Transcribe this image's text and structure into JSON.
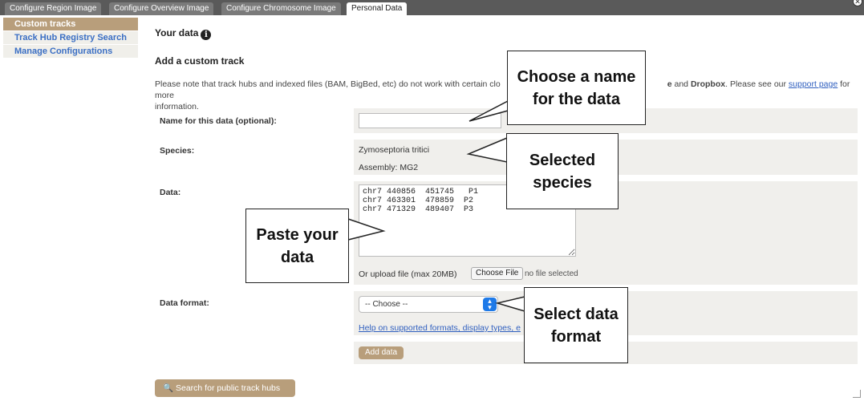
{
  "tabs": [
    {
      "label": "Configure Region Image",
      "active": false
    },
    {
      "label": "Configure Overview Image",
      "active": false
    },
    {
      "label": "Configure Chromosome Image",
      "active": false
    },
    {
      "label": "Personal Data",
      "active": true
    }
  ],
  "sidebar": {
    "items": [
      {
        "label": "Custom tracks",
        "active": true
      },
      {
        "label": "Track Hub Registry Search",
        "active": false
      },
      {
        "label": "Manage Configurations",
        "active": false
      }
    ]
  },
  "main": {
    "title": "Your data",
    "section_title": "Add a custom track",
    "note_part1": "Please note that track hubs and indexed files (BAM, BigBed, etc) do not work with certain clo",
    "note_bold_fragment": "e",
    "note_part2": " and ",
    "note_bold2": "Dropbox",
    "note_part3": ". Please see our ",
    "note_link": "support page",
    "note_part4": " for more",
    "note_line2": "information.",
    "form": {
      "name_label": "Name for this data (optional):",
      "name_value": "",
      "species_label": "Species:",
      "species_value": "Zymoseptoria tritici",
      "assembly_value": "Assembly: MG2",
      "data_label": "Data:",
      "data_value": "chr7 440856  451745   P1\nchr7 463301  478859  P2\nchr7 471329  489407  P3",
      "upload_label": "Or upload file (max 20MB)",
      "choose_file_button": "Choose File",
      "file_status": "no file selected",
      "format_label": "Data format:",
      "format_selected": "-- Choose --",
      "help_link": "Help on supported formats, display types, e",
      "add_button": "Add data"
    },
    "search_hubs_button": "Search for public track hubs"
  },
  "callouts": {
    "name": [
      "Choose a name",
      "for the data"
    ],
    "species": [
      "Selected",
      "species"
    ],
    "paste": [
      "Paste your",
      "data"
    ],
    "format": [
      "Select data",
      "format"
    ]
  }
}
